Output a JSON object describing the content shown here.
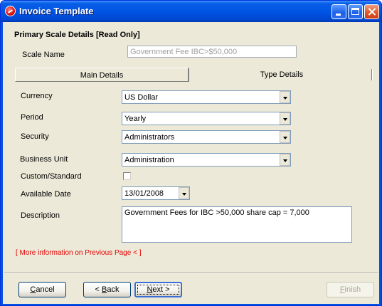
{
  "window": {
    "title": "Invoice Template"
  },
  "section": {
    "title": "Primary Scale Details [Read Only]"
  },
  "scale_name": {
    "label": "Scale Name",
    "value": "Government Fee IBC>$50,000"
  },
  "tabs": [
    {
      "label": "Main Details"
    },
    {
      "label": "Type Details"
    }
  ],
  "fields": {
    "currency": {
      "label": "Currency",
      "value": "US Dollar"
    },
    "period": {
      "label": "Period",
      "value": "Yearly"
    },
    "security": {
      "label": "Security",
      "value": "Administrators"
    },
    "business_unit": {
      "label": "Business Unit",
      "value": "Administration"
    },
    "custom_standard": {
      "label": "Custom/Standard",
      "checked": false
    },
    "available_date": {
      "label": "Available Date",
      "value": "13/01/2008"
    },
    "description": {
      "label": "Description",
      "value": "Government Fees for IBC >50,000 share cap = 7,000"
    }
  },
  "more_info": "[ More information on Previous Page < ]",
  "buttons": {
    "cancel_prefix": "",
    "cancel_underline": "C",
    "cancel_rest": "ancel",
    "back_prefix": "< ",
    "back_underline": "B",
    "back_rest": "ack",
    "next_prefix": "",
    "next_underline": "N",
    "next_rest": "ext >",
    "finish_prefix": "",
    "finish_underline": "F",
    "finish_rest": "inish"
  },
  "colors": {
    "titlebar": "#0054e3",
    "client_bg": "#ece9d8",
    "link_red": "#e00000"
  }
}
